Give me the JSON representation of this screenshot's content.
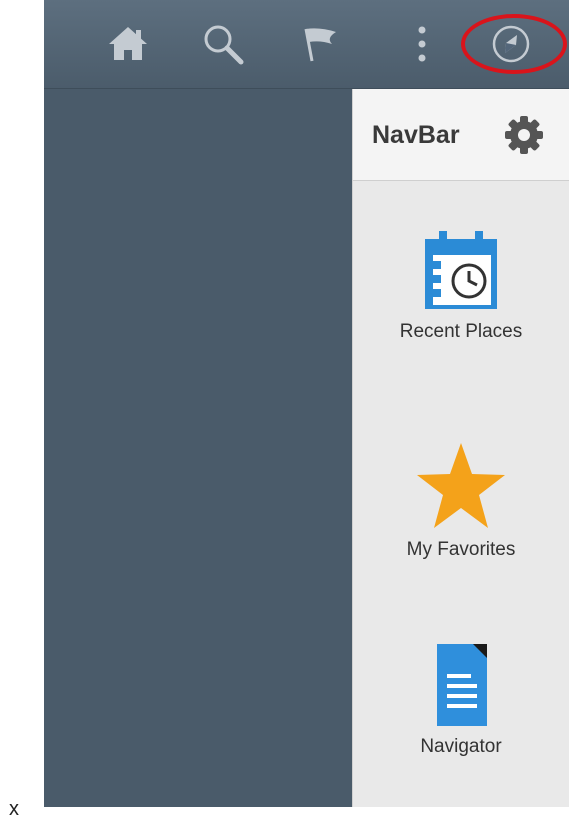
{
  "navbar": {
    "title": "NavBar",
    "items": [
      {
        "label": "Recent Places",
        "icon": "calendar-clock-icon"
      },
      {
        "label": "My Favorites",
        "icon": "star-icon"
      },
      {
        "label": "Navigator",
        "icon": "document-icon"
      }
    ]
  },
  "topbar": {
    "icons": [
      "home-icon",
      "search-icon",
      "flag-icon",
      "more-vertical-icon",
      "compass-icon"
    ]
  },
  "footer": {
    "mark": "x"
  },
  "colors": {
    "header_bg": "#53667a",
    "panel_bg": "#4a5b6a",
    "navbar_bg": "#e9e9e9",
    "highlight": "#d9141b",
    "star": "#f4a21a",
    "calendar_blue": "#2b8bd6",
    "document_blue": "#2f8fdc"
  }
}
